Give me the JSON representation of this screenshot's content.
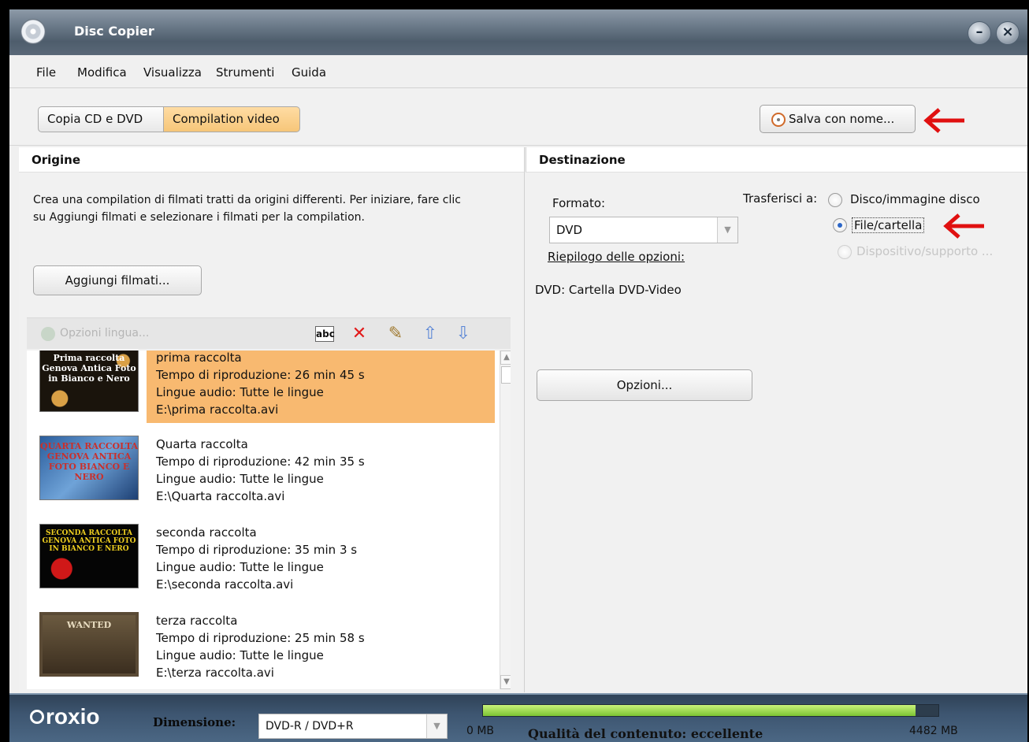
{
  "window": {
    "title": "Disc Copier",
    "minimize_label": "–",
    "close_label": "×"
  },
  "menu": {
    "items": [
      "File",
      "Modifica",
      "Visualizza",
      "Strumenti",
      "Guida"
    ]
  },
  "toolbar": {
    "tabs": [
      {
        "label": "Copia CD e DVD",
        "selected": false
      },
      {
        "label": "Compilation video",
        "selected": true
      }
    ],
    "save_label": "Salva con nome..."
  },
  "origin": {
    "header": "Origine",
    "intro": "Crea una compilation di filmati tratti da origini differenti. Per iniziare, fare clic su Aggiungi filmati e selezionare i filmati per la compilation.",
    "add_button": "Aggiungi filmati...",
    "lang_options": "Opzioni lingua...",
    "thumb_texts": [
      "Prima raccolta Genova Antica Foto in Bianco e Nero",
      "QUARTA RACCOLTA GENOVA ANTICA FOTO BIANCO E NERO",
      "SECONDA RACCOLTA GENOVA ANTICA FOTO IN BIANCO E NERO",
      "WANTED"
    ],
    "items": [
      {
        "title": "prima raccolta",
        "duration": "Tempo di riproduzione: 26 min 45 s",
        "audio": "Lingue audio: Tutte le lingue",
        "path": "E:\\prima raccolta.avi"
      },
      {
        "title": "Quarta raccolta",
        "duration": "Tempo di riproduzione: 42 min 35 s",
        "audio": "Lingue audio: Tutte le lingue",
        "path": "E:\\Quarta raccolta.avi"
      },
      {
        "title": "seconda raccolta",
        "duration": "Tempo di riproduzione: 35 min 3 s",
        "audio": "Lingue audio: Tutte le lingue",
        "path": "E:\\seconda raccolta.avi"
      },
      {
        "title": "terza raccolta",
        "duration": "Tempo di riproduzione: 25 min 58 s",
        "audio": "Lingue audio: Tutte le lingue",
        "path": "E:\\terza raccolta.avi"
      }
    ]
  },
  "destination": {
    "header": "Destinazione",
    "format_label": "Formato:",
    "format_value": "DVD",
    "transfer_label": "Trasferisci a:",
    "options": [
      {
        "label": "Disco/immagine disco",
        "selected": false,
        "enabled": true
      },
      {
        "label": "File/cartella",
        "selected": true,
        "enabled": true
      },
      {
        "label": "Dispositivo/supporto ...",
        "selected": false,
        "enabled": false
      }
    ],
    "summary_link": "Riepilogo delle opzioni:",
    "summary_text": "DVD: Cartella DVD-Video",
    "options_button": "Opzioni..."
  },
  "status": {
    "brand": "roxio",
    "size_label": "Dimensione:",
    "size_value": "DVD-R / DVD+R",
    "capacity_min": "0 MB",
    "capacity_max": "4482 MB",
    "capacity_used_fraction": 0.95,
    "quality": "Qualità del contenuto: eccellente"
  },
  "colors": {
    "selection": "#f8b970",
    "accent_arrow": "#e01010",
    "capacity_fill": "#8fd13d"
  }
}
